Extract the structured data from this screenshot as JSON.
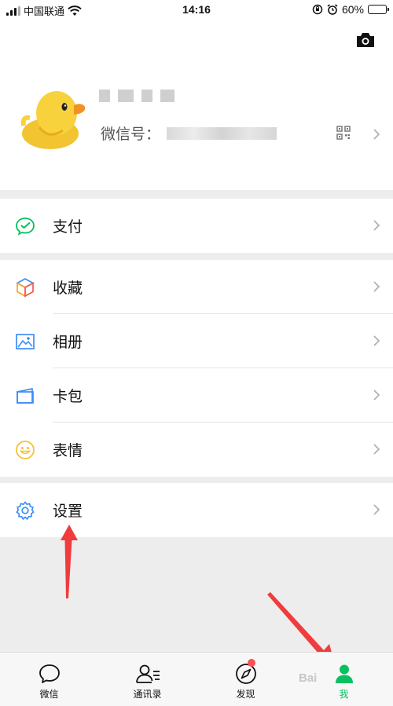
{
  "status_bar": {
    "carrier": "中国联通",
    "time": "14:16",
    "battery": "60%",
    "battery_level": 0.6
  },
  "profile": {
    "wechat_id_label": "微信号："
  },
  "menu": {
    "pay": "支付",
    "favorites": "收藏",
    "album": "相册",
    "cards": "卡包",
    "stickers": "表情",
    "settings": "设置"
  },
  "tabbar": {
    "chats": "微信",
    "contacts": "通讯录",
    "discover": "发现",
    "me": "我",
    "active": "me"
  },
  "colors": {
    "accent_green": "#07c160",
    "badge_red": "#fa5151",
    "arrow_red": "#f03c3c",
    "background": "#ededed"
  },
  "watermark": "Bai"
}
